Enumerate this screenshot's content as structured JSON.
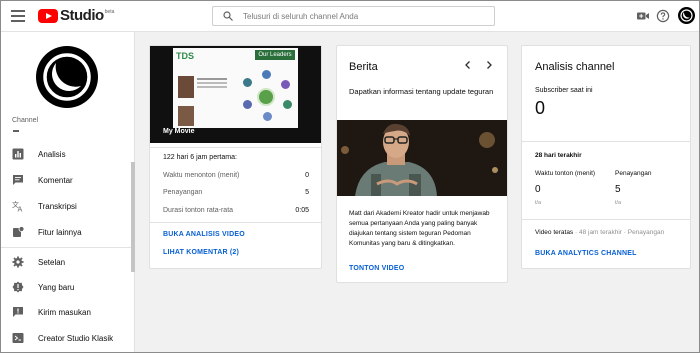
{
  "app": {
    "logo_text": "Studio",
    "logo_badge": "beta",
    "search_placeholder": "Telusuri di seluruh channel Anda"
  },
  "sidebar": {
    "section_label": "Channel",
    "items": [
      {
        "label": "Analisis",
        "icon": "analytics-icon"
      },
      {
        "label": "Komentar",
        "icon": "comments-icon"
      },
      {
        "label": "Transkripsi",
        "icon": "translate-icon"
      },
      {
        "label": "Fitur lainnya",
        "icon": "more-features-icon"
      },
      {
        "label": "Setelan",
        "icon": "settings-icon"
      },
      {
        "label": "Yang baru",
        "icon": "whats-new-icon"
      },
      {
        "label": "Kirim masukan",
        "icon": "feedback-icon"
      },
      {
        "label": "Creator Studio Klasik",
        "icon": "classic-studio-icon"
      }
    ]
  },
  "video_card": {
    "thumbnail_title": "My Movie",
    "slide_logo": "TDS",
    "slide_heading": "Our Leaders",
    "period": "122 hari 6 jam pertama:",
    "stats": [
      {
        "label": "Waktu menonton (menit)",
        "value": "0"
      },
      {
        "label": "Penayangan",
        "value": "5"
      },
      {
        "label": "Durasi tonton rata-rata",
        "value": "0:05"
      }
    ],
    "link_analytics": "BUKA ANALISIS VIDEO",
    "link_comments": "LIHAT KOMENTAR (2)"
  },
  "news_card": {
    "title": "Berita",
    "headline": "Dapatkan informasi tentang update teguran",
    "body": "Matt dari Akademi Kreator hadir untuk menjawab semua pertanyaan Anda yang paling banyak diajukan tentang sistem teguran Pedoman Komunitas yang baru & ditingkatkan.",
    "link": "TONTON VIDEO"
  },
  "analytics_card": {
    "title": "Analisis channel",
    "subscriber_label": "Subscriber saat ini",
    "subscriber_count": "0",
    "period": "28 hari terakhir",
    "metrics": [
      {
        "label": "Waktu tonton (menit)",
        "value": "0",
        "sub": "t/a"
      },
      {
        "label": "Penayangan",
        "value": "5",
        "sub": "t/a"
      }
    ],
    "top_videos_label": "Video teratas",
    "top_videos_meta": " · 48 jam terakhir · Penayangan",
    "link": "BUKA ANALYTICS CHANNEL"
  }
}
